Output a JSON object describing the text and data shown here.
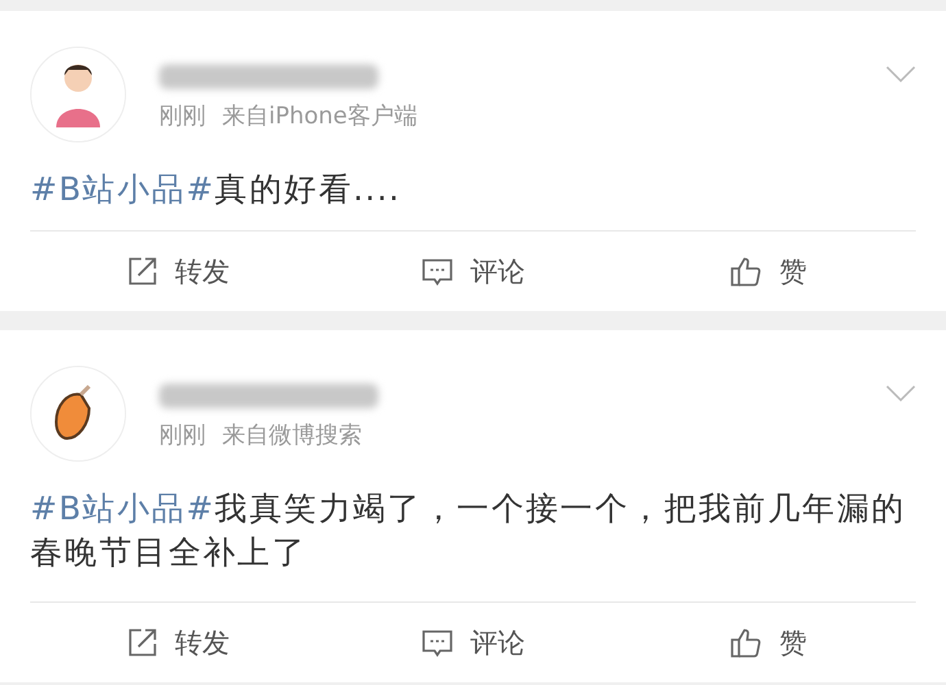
{
  "posts": [
    {
      "time": "刚刚",
      "source": "来自iPhone客户端",
      "hashtag": "#B站小品#",
      "text": "真的好看....",
      "actions": [
        {
          "kind": "repost",
          "label": "转发"
        },
        {
          "kind": "comment",
          "label": "评论"
        },
        {
          "kind": "like",
          "label": "赞"
        }
      ]
    },
    {
      "time": "刚刚",
      "source": "来自微博搜索",
      "hashtag": "#B站小品#",
      "text": "我真笑力竭了，一个接一个，把我前几年漏的春晚节目全补上了",
      "actions": [
        {
          "kind": "repost",
          "label": "转发"
        },
        {
          "kind": "comment",
          "label": "评论"
        },
        {
          "kind": "like",
          "label": "赞"
        }
      ]
    }
  ]
}
